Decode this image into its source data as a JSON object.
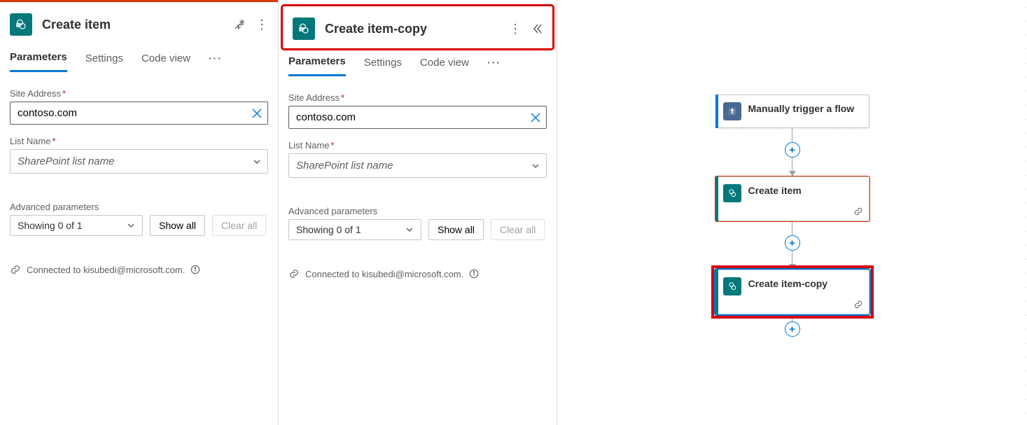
{
  "panels": [
    {
      "title": "Create item",
      "accent": "orange",
      "highlightHeader": false,
      "header_actions": [
        "pin",
        "more"
      ],
      "tabs": {
        "parameters": "Parameters",
        "settings": "Settings",
        "codeview": "Code view"
      },
      "siteAddress": {
        "label": "Site Address",
        "value": "contoso.com"
      },
      "listName": {
        "label": "List Name",
        "placeholder": "SharePoint list name"
      },
      "advanced": {
        "label": "Advanced parameters",
        "summary": "Showing 0 of 1",
        "showAll": "Show all",
        "clearAll": "Clear all"
      },
      "connected": "Connected to kisubedi@microsoft.com."
    },
    {
      "title": "Create item-copy",
      "accent": "none",
      "highlightHeader": true,
      "header_actions": [
        "more",
        "collapse"
      ],
      "tabs": {
        "parameters": "Parameters",
        "settings": "Settings",
        "codeview": "Code view"
      },
      "siteAddress": {
        "label": "Site Address",
        "value": "contoso.com"
      },
      "listName": {
        "label": "List Name",
        "placeholder": "SharePoint list name"
      },
      "advanced": {
        "label": "Advanced parameters",
        "summary": "Showing 0 of 1",
        "showAll": "Show all",
        "clearAll": "Clear all"
      },
      "connected": "Connected to kisubedi@microsoft.com."
    }
  ],
  "canvas": {
    "nodes": [
      {
        "kind": "trigger",
        "title": "Manually trigger a flow",
        "accent": "#0078d4"
      },
      {
        "kind": "action",
        "title": "Create item",
        "accent": "#02787a",
        "selection": "orange"
      },
      {
        "kind": "action",
        "title": "Create item-copy",
        "accent": "#02787a",
        "selection": "red-blue"
      }
    ]
  }
}
